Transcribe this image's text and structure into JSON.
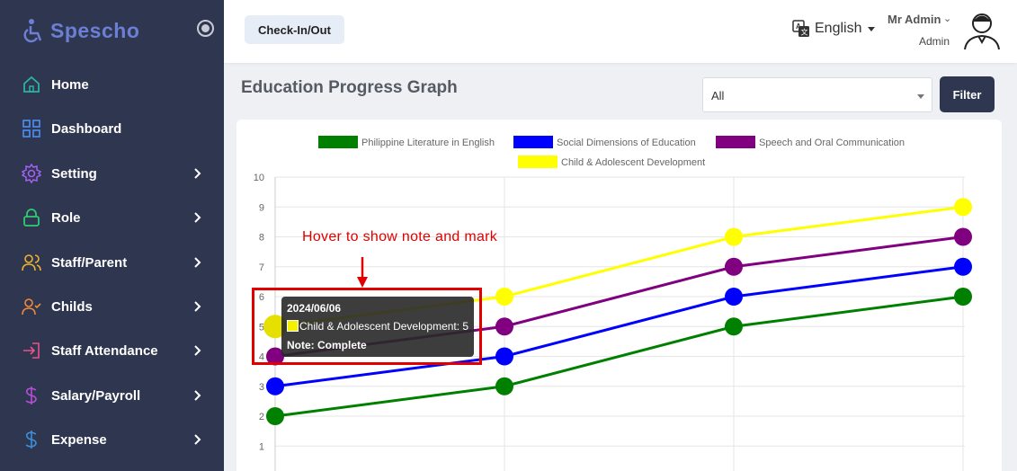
{
  "app": {
    "name": "Spescho"
  },
  "sidebar": {
    "items": [
      {
        "label": "Home",
        "icon": "home-icon",
        "color": "#2bb3a3",
        "has_children": false
      },
      {
        "label": "Dashboard",
        "icon": "grid-icon",
        "color": "#4e8ff5",
        "has_children": false
      },
      {
        "label": "Setting",
        "icon": "gear-icon",
        "color": "#a561f0",
        "has_children": true
      },
      {
        "label": "Role",
        "icon": "lock-icon",
        "color": "#2ecc71",
        "has_children": true
      },
      {
        "label": "Staff/Parent",
        "icon": "users-icon",
        "color": "#f1b32b",
        "has_children": true
      },
      {
        "label": "Childs",
        "icon": "user-check-icon",
        "color": "#f08a3c",
        "has_children": true
      },
      {
        "label": "Staff Attendance",
        "icon": "login-icon",
        "color": "#e9528a",
        "has_children": true
      },
      {
        "label": "Salary/Payroll",
        "icon": "dollar-icon",
        "color": "#b44fd6",
        "has_children": true
      },
      {
        "label": "Expense",
        "icon": "dollar-icon",
        "color": "#3d8fd8",
        "has_children": true
      }
    ]
  },
  "topbar": {
    "checkin_label": "Check-In/Out",
    "language": "English",
    "user_name": "Mr Admin",
    "user_role": "Admin"
  },
  "main": {
    "title": "Education Progress Graph",
    "filter_select_value": "All",
    "filter_button": "Filter"
  },
  "annotation": {
    "hover_note": "Hover to show note and mark"
  },
  "tooltip": {
    "date": "2024/06/06",
    "line": "Child & Adolescent Development: 5",
    "note": "Note: Complete"
  },
  "chart_data": {
    "type": "line",
    "categories": [
      "",
      "",
      "",
      ""
    ],
    "ylim": [
      0,
      10
    ],
    "yticks": [
      1,
      2,
      3,
      4,
      5,
      6,
      7,
      8,
      9,
      10
    ],
    "legend_position": "top",
    "grid": true,
    "series": [
      {
        "name": "Philippine Literature in English",
        "color": "#008000",
        "values": [
          2,
          3,
          5,
          6
        ]
      },
      {
        "name": "Social Dimensions of Education",
        "color": "#0000ff",
        "values": [
          3,
          4,
          6,
          7
        ]
      },
      {
        "name": "Speech and Oral Communication",
        "color": "#800080",
        "values": [
          4,
          5,
          7,
          8
        ]
      },
      {
        "name": "Child & Adolescent Development",
        "color": "#ffff00",
        "values": [
          5,
          6,
          8,
          9
        ]
      }
    ]
  }
}
